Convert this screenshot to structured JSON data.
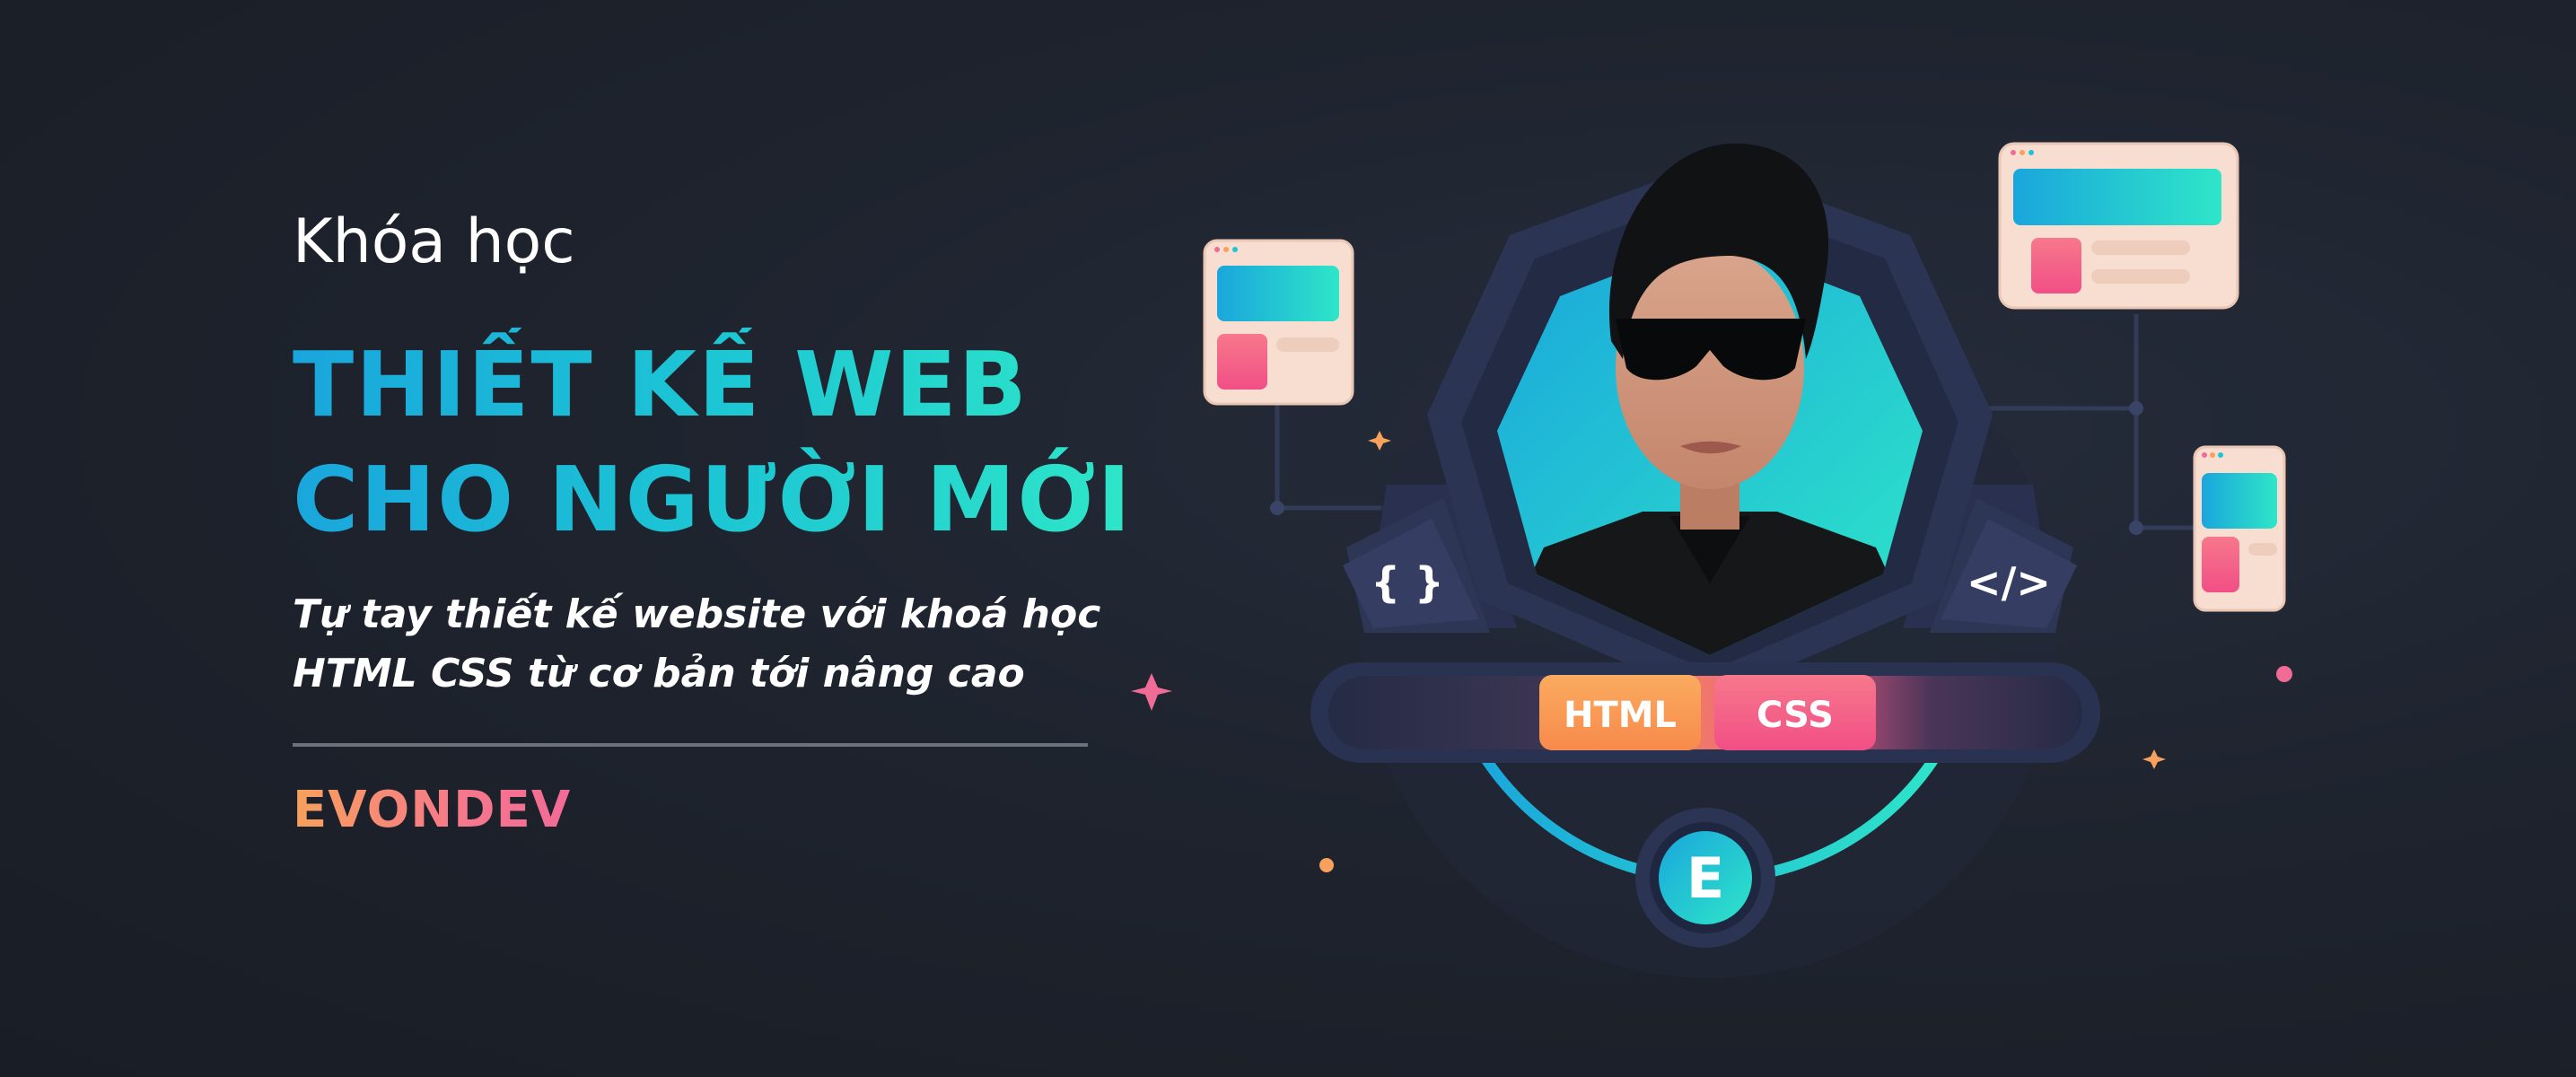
{
  "banner": {
    "kicker": "Khóa học",
    "title_line1": "THIẾT KẾ WEB",
    "title_line2": "CHO NGƯỜI MỚI",
    "subtitle_line1": "Tự tay thiết kế website với khoá học",
    "subtitle_line2": "HTML CSS từ cơ bản tới nâng cao",
    "brand": "EVONDEV"
  },
  "illustration": {
    "tag_html": "HTML",
    "tag_css": "CSS",
    "left_icon_glyph": "{ }",
    "right_icon_glyph": "</>",
    "logo_letter": "E",
    "icons": [
      "curly-braces-icon",
      "code-brackets-icon",
      "evondev-logo-icon",
      "browser-window-icon",
      "sparkle-icon"
    ],
    "colors": {
      "accent_cyan": "#1cc6d4",
      "accent_blue": "#1aa6dc",
      "accent_teal": "#2ee6c8",
      "accent_orange": "#f7a15c",
      "accent_pink": "#f16b97",
      "background": "#1d222c"
    }
  }
}
